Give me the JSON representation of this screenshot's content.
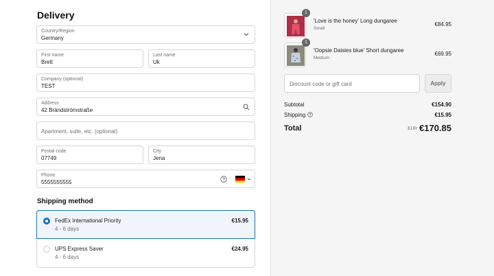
{
  "delivery": {
    "heading": "Delivery",
    "country": {
      "label": "Country/Region",
      "value": "Germany"
    },
    "first_name": {
      "label": "First name",
      "value": "Brett"
    },
    "last_name": {
      "label": "Last name",
      "value": "Uk"
    },
    "company": {
      "label": "Company (optional)",
      "value": "TEST"
    },
    "address": {
      "label": "Address",
      "value": "42 Brändströmstraße"
    },
    "apartment": {
      "placeholder": "Apartment, suite, etc. (optional)"
    },
    "postal_code": {
      "label": "Postal code",
      "value": "07749"
    },
    "city": {
      "label": "City",
      "value": "Jena"
    },
    "phone": {
      "label": "Phone",
      "value": "5555555555",
      "flag": "germany-flag-icon"
    }
  },
  "shipping": {
    "heading": "Shipping method",
    "options": [
      {
        "name": "FedEx International Priority",
        "days": "4 - 6 days",
        "price": "€15.95",
        "selected": true
      },
      {
        "name": "UPS Express Saver",
        "days": "4 - 6 days",
        "price": "€24.95",
        "selected": false
      }
    ]
  },
  "summary": {
    "items": [
      {
        "name": "'Love is the honey' Long dungaree",
        "variant": "Small",
        "price": "€84.95",
        "quantity": "1"
      },
      {
        "name": "'Oopsie Daisies blue' Short dungaree",
        "variant": "Medium",
        "price": "€69.95",
        "quantity": "1"
      }
    ],
    "discount_placeholder": "Discount code or gift card",
    "apply_label": "Apply",
    "subtotal_label": "Subtotal",
    "subtotal_value": "€154.90",
    "shipping_label": "Shipping",
    "shipping_value": "€15.95",
    "total_label": "Total",
    "currency": "EUR",
    "total_value": "€170.85"
  },
  "colors": {
    "accent": "#1773b0",
    "selected_bg": "#f0f5fb",
    "summary_bg": "#f5f5f5"
  }
}
